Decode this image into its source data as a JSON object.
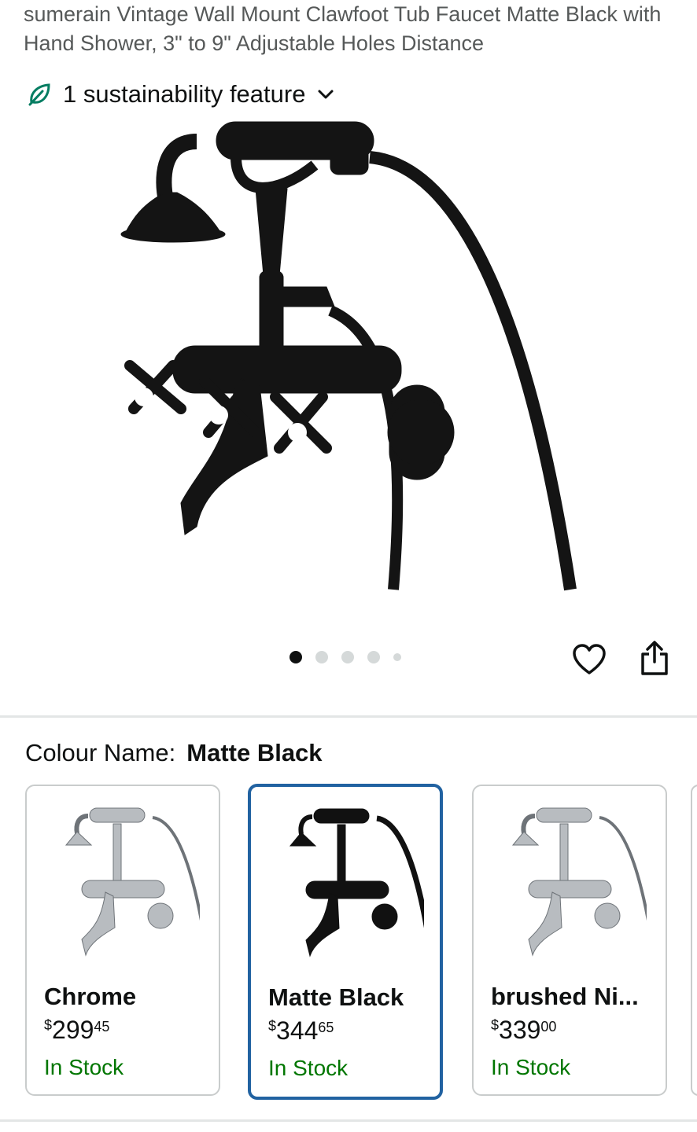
{
  "product": {
    "title": "sumerain Vintage Wall Mount Clawfoot Tub Faucet Matte Black with Hand Shower, 3\" to 9\" Adjustable Holes Distance",
    "sustainability_label": "1 sustainability feature",
    "image_count": 5,
    "active_image": 1
  },
  "colour": {
    "label": "Colour Name:",
    "selected": "Matte Black"
  },
  "variants": [
    {
      "name": "Chrome",
      "symbol": "$",
      "whole": "299",
      "fraction": "45",
      "stock": "In Stock",
      "finish_color": "#b8bcc0"
    },
    {
      "name": "Matte Black",
      "symbol": "$",
      "whole": "344",
      "fraction": "65",
      "stock": "In Stock",
      "finish_color": "#111111"
    },
    {
      "name": "brushed Ni...",
      "symbol": "$",
      "whole": "339",
      "fraction": "00",
      "stock": "In Stock",
      "finish_color": "#b8bcc0"
    }
  ],
  "icons": {
    "leaf": "leaf-icon",
    "chevron": "chevron-down-icon",
    "heart": "heart-icon",
    "share": "share-icon"
  },
  "colors": {
    "accent_selected": "#2162a1",
    "in_stock": "#007600",
    "leaf": "#067d62"
  }
}
